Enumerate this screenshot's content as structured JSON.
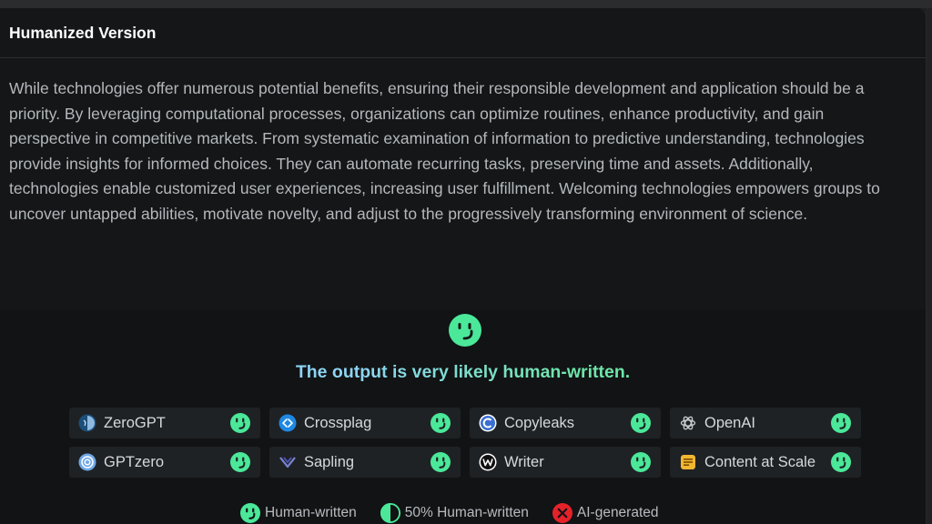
{
  "panel": {
    "title": "Humanized Version",
    "body": "While technologies offer numerous potential benefits, ensuring their responsible development and application should be a priority. By leveraging computational processes, organizations can optimize routines, enhance productivity, and gain perspective in competitive markets. From systematic examination of information to predictive understanding, technologies provide insights for informed choices. They can automate recurring tasks, preserving time and assets. Additionally, technologies enable customized user experiences, increasing user fulfillment. Welcoming technologies empowers groups to uncover untapped abilities, motivate novelty, and adjust to the progressively transforming environment of science."
  },
  "result": {
    "status_icon": "smiley-human-icon",
    "message": "The output is very likely human-written."
  },
  "detectors": [
    {
      "name": "ZeroGPT",
      "icon": "zerogpt-logo-icon",
      "result": "human"
    },
    {
      "name": "Crossplag",
      "icon": "crossplag-logo-icon",
      "result": "human"
    },
    {
      "name": "Copyleaks",
      "icon": "copyleaks-logo-icon",
      "result": "human"
    },
    {
      "name": "OpenAI",
      "icon": "openai-logo-icon",
      "result": "human"
    },
    {
      "name": "GPTzero",
      "icon": "gptzero-logo-icon",
      "result": "human"
    },
    {
      "name": "Sapling",
      "icon": "sapling-logo-icon",
      "result": "human"
    },
    {
      "name": "Writer",
      "icon": "writer-logo-icon",
      "result": "human"
    },
    {
      "name": "Content at Scale",
      "icon": "content-at-scale-logo-icon",
      "result": "human"
    }
  ],
  "legend": {
    "human": "Human-written",
    "half": "50% Human-written",
    "ai": "AI-generated"
  },
  "colors": {
    "human_green": "#4be89a",
    "ai_red": "#e5212a",
    "message_blue": "#8fd4f4",
    "message_green": "#6ee6a9"
  }
}
